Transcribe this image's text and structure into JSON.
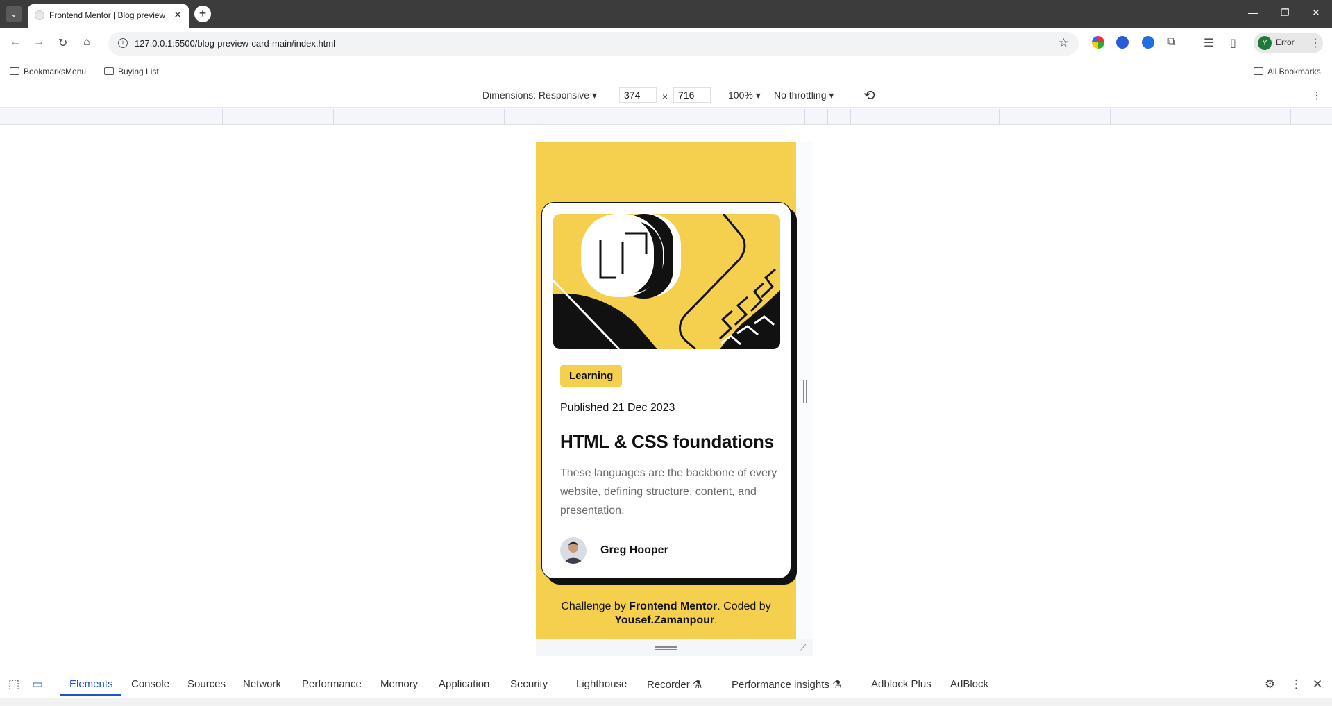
{
  "browser": {
    "tab_title": "Frontend Mentor | Blog preview",
    "tab_close": "✕",
    "new_tab": "+",
    "url": "127.0.0.1:5500/blog-preview-card-main/index.html",
    "profile_initial": "Y",
    "profile_status": "Error",
    "bookmarks": [
      "BookmarksMenu",
      "Buying List"
    ],
    "all_bookmarks": "All Bookmarks"
  },
  "device_toolbar": {
    "dimensions_label": "Dimensions: Responsive ▾",
    "width": "374",
    "times": "×",
    "height": "716",
    "zoom": "100% ▾",
    "throttling": "No throttling ▾"
  },
  "card": {
    "category": "Learning",
    "published": "Published 21 Dec 2023",
    "title": "HTML & CSS foundations",
    "description": "These languages are the backbone of every website, defining structure, content, and presentation.",
    "author": "Greg Hooper"
  },
  "attribution": {
    "prefix": "Challenge by ",
    "link1": "Frontend Mentor",
    "middle": ". Coded by ",
    "link2": "Yousef.Zamanpour",
    "suffix": "."
  },
  "devtools": {
    "tabs": [
      "Elements",
      "Console",
      "Sources",
      "Network",
      "Performance",
      "Memory",
      "Application",
      "Security",
      "Lighthouse",
      "Recorder ⚗",
      "Performance insights ⚗",
      "Adblock Plus",
      "AdBlock"
    ],
    "active_tab": "Elements"
  },
  "colors": {
    "accent": "#f4d04e",
    "ink": "#111111",
    "devtools_active": "#1a56c8"
  }
}
